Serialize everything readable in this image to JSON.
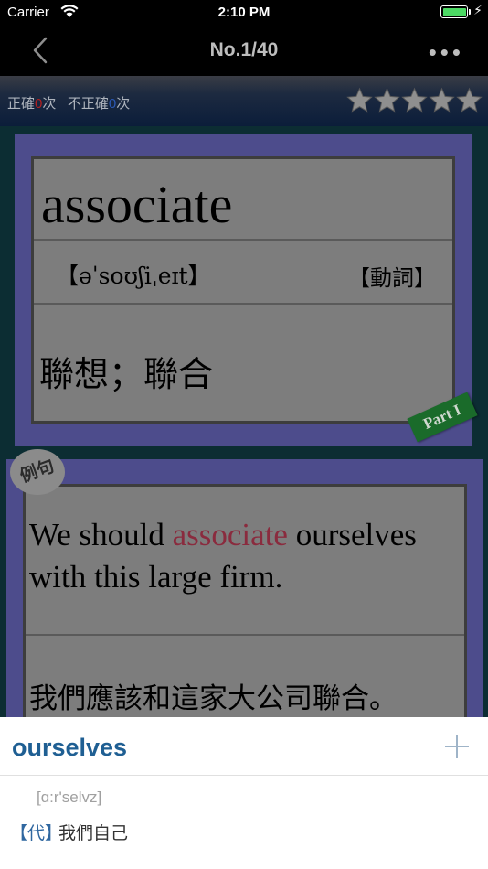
{
  "status_bar": {
    "carrier": "Carrier",
    "time": "2:10 PM",
    "battery_color": "#4cd964"
  },
  "nav": {
    "title": "No.1/40",
    "back_icon": "chevron-left-icon",
    "more_icon": "ellipsis-icon",
    "more_glyph": "•••"
  },
  "stats": {
    "correct_label": "正確",
    "correct_count": "0",
    "correct_suffix": "次",
    "incorrect_label": "不正確",
    "incorrect_count": "0",
    "incorrect_suffix": "次",
    "rating_stars": 5,
    "rating_filled": 0
  },
  "card": {
    "word": "associate",
    "phonetic": "【əˈsoʊʃiˌeɪt】",
    "part_of_speech": "【動詞】",
    "meaning": "聯想；聯合",
    "part_tag": "Part I"
  },
  "example": {
    "badge": "例句",
    "en_before": "We should ",
    "en_highlight": "associate",
    "en_after": " ourselves with this large firm.",
    "zh": "我們應該和這家大公司聯合。"
  },
  "lookup_popup": {
    "word": "ourselves",
    "phonetic": "[ɑ:r'selvz]",
    "pos": "【代】",
    "meaning": "我們自己",
    "add_icon": "plus-icon"
  },
  "colors": {
    "card_frame": "#4d4c8c",
    "card_body": "#7d7d7d",
    "highlight": "#8a2b3e",
    "popup_word": "#1f5f93",
    "correct_count": "#b32020",
    "incorrect_count": "#2a59b5"
  }
}
